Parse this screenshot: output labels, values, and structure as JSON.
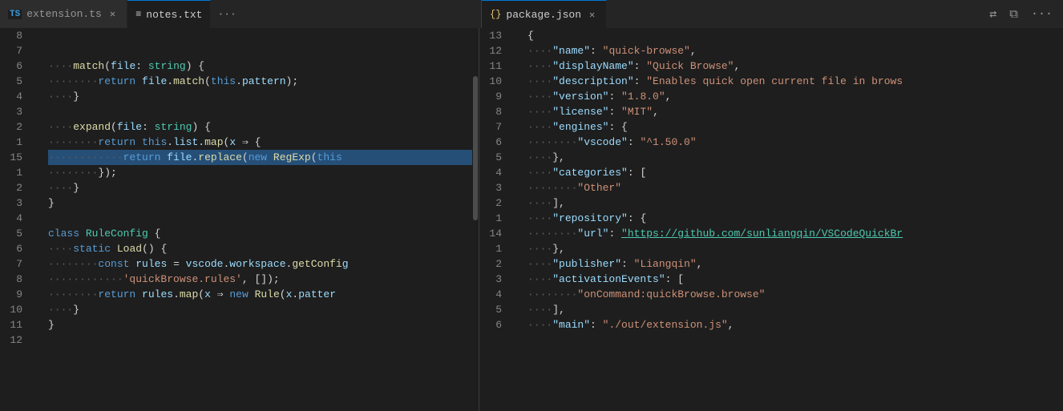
{
  "tabs": {
    "left": {
      "tabs": [
        {
          "label": "extension.ts",
          "icon": "TS",
          "active": false,
          "closeable": true
        },
        {
          "label": "notes.txt",
          "icon": "≡",
          "active": true,
          "closeable": false
        }
      ],
      "overflow_label": "···"
    },
    "right": {
      "tabs": [
        {
          "label": "package.json",
          "icon": "{}",
          "active": true,
          "closeable": true
        }
      ],
      "actions": [
        "layout-icon",
        "split-icon",
        "more-icon"
      ]
    }
  },
  "left_code": {
    "lines": [
      {
        "num": "8",
        "content_html": ""
      },
      {
        "num": "7",
        "content_html": ""
      },
      {
        "num": "6",
        "content_html": "<span class='dots'>····</span><span class='fn'>match</span><span class='punct'>(</span><span class='param'>file</span><span class='punct'>: </span><span class='type'>string</span><span class='punct'>) {</span>"
      },
      {
        "num": "5",
        "content_html": "<span class='dots'>········</span><span class='kw'>return</span><span class='punct'> </span><span class='param'>file</span><span class='punct'>.</span><span class='fn'>match</span><span class='punct'>(</span><span class='kw'>this</span><span class='punct'>.</span><span class='param'>pattern</span><span class='punct'>);</span>"
      },
      {
        "num": "4",
        "content_html": "<span class='dots'>····</span><span class='punct'>}</span>"
      },
      {
        "num": "3",
        "content_html": ""
      },
      {
        "num": "2",
        "content_html": "<span class='dots'>····</span><span class='fn'>expand</span><span class='punct'>(</span><span class='param'>file</span><span class='punct'>: </span><span class='type'>string</span><span class='punct'>) {</span>"
      },
      {
        "num": "1",
        "content_html": "<span class='dots'>········</span><span class='kw'>return</span><span class='punct'> </span><span class='kw'>this</span><span class='punct'>.</span><span class='param'>list</span><span class='punct'>.</span><span class='fn'>map</span><span class='punct'>(</span><span class='param'>x</span><span class='punct'> ⇒ {</span>"
      },
      {
        "num": "15",
        "content_html": "<span class='dots'>············</span><span class='kw'>return</span><span class='punct'> </span><span class='param'>file</span><span class='punct'>.</span><span class='fn'>replace</span><span class='punct'>(</span><span class='kw'>new</span><span class='punct'> </span><span class='fn'>RegExp</span><span class='punct'>(</span><span class='kw'>this</span>",
        "highlight": true
      },
      {
        "num": "1",
        "content_html": "<span class='dots'>········</span><span class='punct'>});</span>"
      },
      {
        "num": "2",
        "content_html": "<span class='dots'>····</span><span class='punct'>}</span>"
      },
      {
        "num": "3",
        "content_html": "<span class='punct'>}</span>"
      },
      {
        "num": "4",
        "content_html": ""
      },
      {
        "num": "5",
        "content_html": "<span class='kw'>class</span><span class='punct'> </span><span class='type'>RuleConfig</span><span class='punct'> {</span>"
      },
      {
        "num": "6",
        "content_html": "<span class='dots'>····</span><span class='kw'>static</span><span class='punct'> </span><span class='fn'>Load</span><span class='punct'>() {</span>"
      },
      {
        "num": "7",
        "content_html": "<span class='dots'>········</span><span class='kw'>const</span><span class='punct'> </span><span class='param'>rules</span><span class='punct'> = </span><span class='param'>vscode</span><span class='punct'>.</span><span class='param'>workspace</span><span class='punct'>.</span><span class='fn'>getConfi</span><span class='param'>g</span>"
      },
      {
        "num": "8",
        "content_html": "<span class='dots'>············</span><span class='str'>'quickBrowse.rules'</span><span class='punct'>, []);</span>"
      },
      {
        "num": "9",
        "content_html": "<span class='dots'>········</span><span class='kw'>return</span><span class='punct'> </span><span class='param'>rules</span><span class='punct'>.</span><span class='fn'>map</span><span class='punct'>(</span><span class='param'>x</span><span class='punct'> ⇒ </span><span class='kw'>new</span><span class='punct'> </span><span class='fn'>Rule</span><span class='punct'>(</span><span class='param'>x</span><span class='punct'>.</span><span class='param'>patter</span>"
      },
      {
        "num": "10",
        "content_html": "<span class='dots'>····</span><span class='punct'>}</span>"
      },
      {
        "num": "11",
        "content_html": "<span class='punct'>}</span>"
      },
      {
        "num": "12",
        "content_html": ""
      }
    ]
  },
  "right_code": {
    "lines": [
      {
        "num": "13",
        "content_html": "<span class='punct'>{</span>"
      },
      {
        "num": "12",
        "content_html": "<span class='dots'>····</span><span class='json-key'>\"name\"</span><span class='punct'>: </span><span class='json-str'>\"quick-browse\"</span><span class='punct'>,</span>"
      },
      {
        "num": "11",
        "content_html": "<span class='dots'>····</span><span class='json-key'>\"displayName\"</span><span class='punct'>: </span><span class='json-str'>\"Quick Browse\"</span><span class='punct'>,</span>"
      },
      {
        "num": "10",
        "content_html": "<span class='dots'>····</span><span class='json-key'>\"description\"</span><span class='punct'>: </span><span class='json-str'>\"Enables quick open current file in brows</span>"
      },
      {
        "num": "9",
        "content_html": "<span class='dots'>····</span><span class='json-key'>\"version\"</span><span class='punct'>: </span><span class='json-str'>\"1.8.0\"</span><span class='punct'>,</span>"
      },
      {
        "num": "8",
        "content_html": "<span class='dots'>····</span><span class='json-key'>\"license\"</span><span class='punct'>: </span><span class='json-str'>\"MIT\"</span><span class='punct'>,</span>"
      },
      {
        "num": "7",
        "content_html": "<span class='dots'>····</span><span class='json-key'>\"engines\"</span><span class='punct'>: {</span>"
      },
      {
        "num": "6",
        "content_html": "<span class='dots'>········</span><span class='json-key'>\"vscode\"</span><span class='punct'>: </span><span class='json-str'>\"^1.50.0\"</span>"
      },
      {
        "num": "5",
        "content_html": "<span class='dots'>····</span><span class='punct'>},</span>"
      },
      {
        "num": "4",
        "content_html": "<span class='dots'>····</span><span class='json-key'>\"categories\"</span><span class='punct'>: [</span>"
      },
      {
        "num": "3",
        "content_html": "<span class='dots'>········</span><span class='json-str'>\"Other\"</span>"
      },
      {
        "num": "2",
        "content_html": "<span class='dots'>····</span><span class='punct'>],</span>"
      },
      {
        "num": "1",
        "content_html": "<span class='dots'>····</span><span class='json-key'>\"repository\"</span><span class='punct'>: {</span>"
      },
      {
        "num": "14",
        "content_html": "<span class='dots'>········</span><span class='json-key'>\"url\"</span><span class='punct'>: </span><span class='link'>\"https://github.com/sunliangqin/VSCodeQuickBr</span>"
      },
      {
        "num": "1",
        "content_html": "<span class='dots'>····</span><span class='punct'>},</span>"
      },
      {
        "num": "2",
        "content_html": "<span class='dots'>····</span><span class='json-key'>\"publisher\"</span><span class='punct'>: </span><span class='json-str'>\"Liangqin\"</span><span class='punct'>,</span>"
      },
      {
        "num": "3",
        "content_html": "<span class='dots'>····</span><span class='json-key'>\"activationEvents\"</span><span class='punct'>: [</span>"
      },
      {
        "num": "4",
        "content_html": "<span class='dots'>········</span><span class='json-str'>\"onCommand:quickBrowse.browse\"</span>"
      },
      {
        "num": "5",
        "content_html": "<span class='dots'>····</span><span class='punct'>],</span>"
      },
      {
        "num": "6",
        "content_html": "<span class='dots'>····</span><span class='json-key'>\"main\"</span><span class='punct'>: </span><span class='json-str'>\"./out/extension.js\"</span><span class='punct'>,</span>"
      }
    ]
  }
}
